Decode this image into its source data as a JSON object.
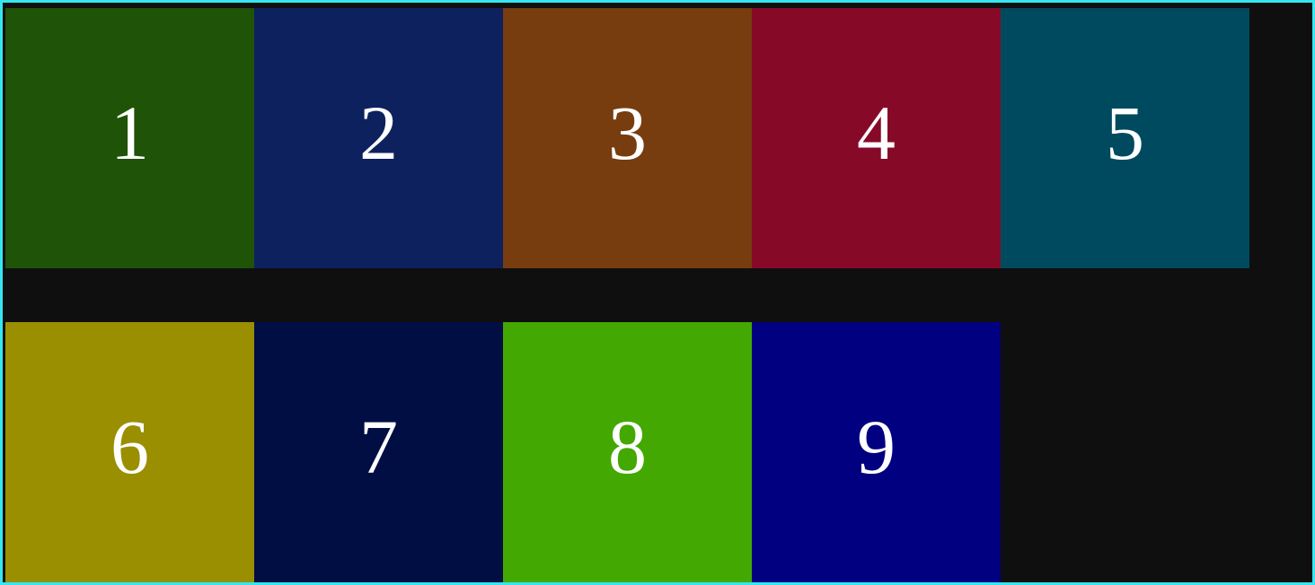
{
  "tiles": [
    {
      "label": "1",
      "color": "#1f5307"
    },
    {
      "label": "2",
      "color": "#0d215e"
    },
    {
      "label": "3",
      "color": "#773d0f"
    },
    {
      "label": "4",
      "color": "#860a28"
    },
    {
      "label": "5",
      "color": "#004a60"
    },
    {
      "label": "6",
      "color": "#9a8f00"
    },
    {
      "label": "7",
      "color": "#000e44"
    },
    {
      "label": "8",
      "color": "#43a801"
    },
    {
      "label": "9",
      "color": "#000080"
    }
  ],
  "theme": {
    "background": "#0f0f0f",
    "border": "#35e6f0",
    "text": "#ffffff"
  }
}
